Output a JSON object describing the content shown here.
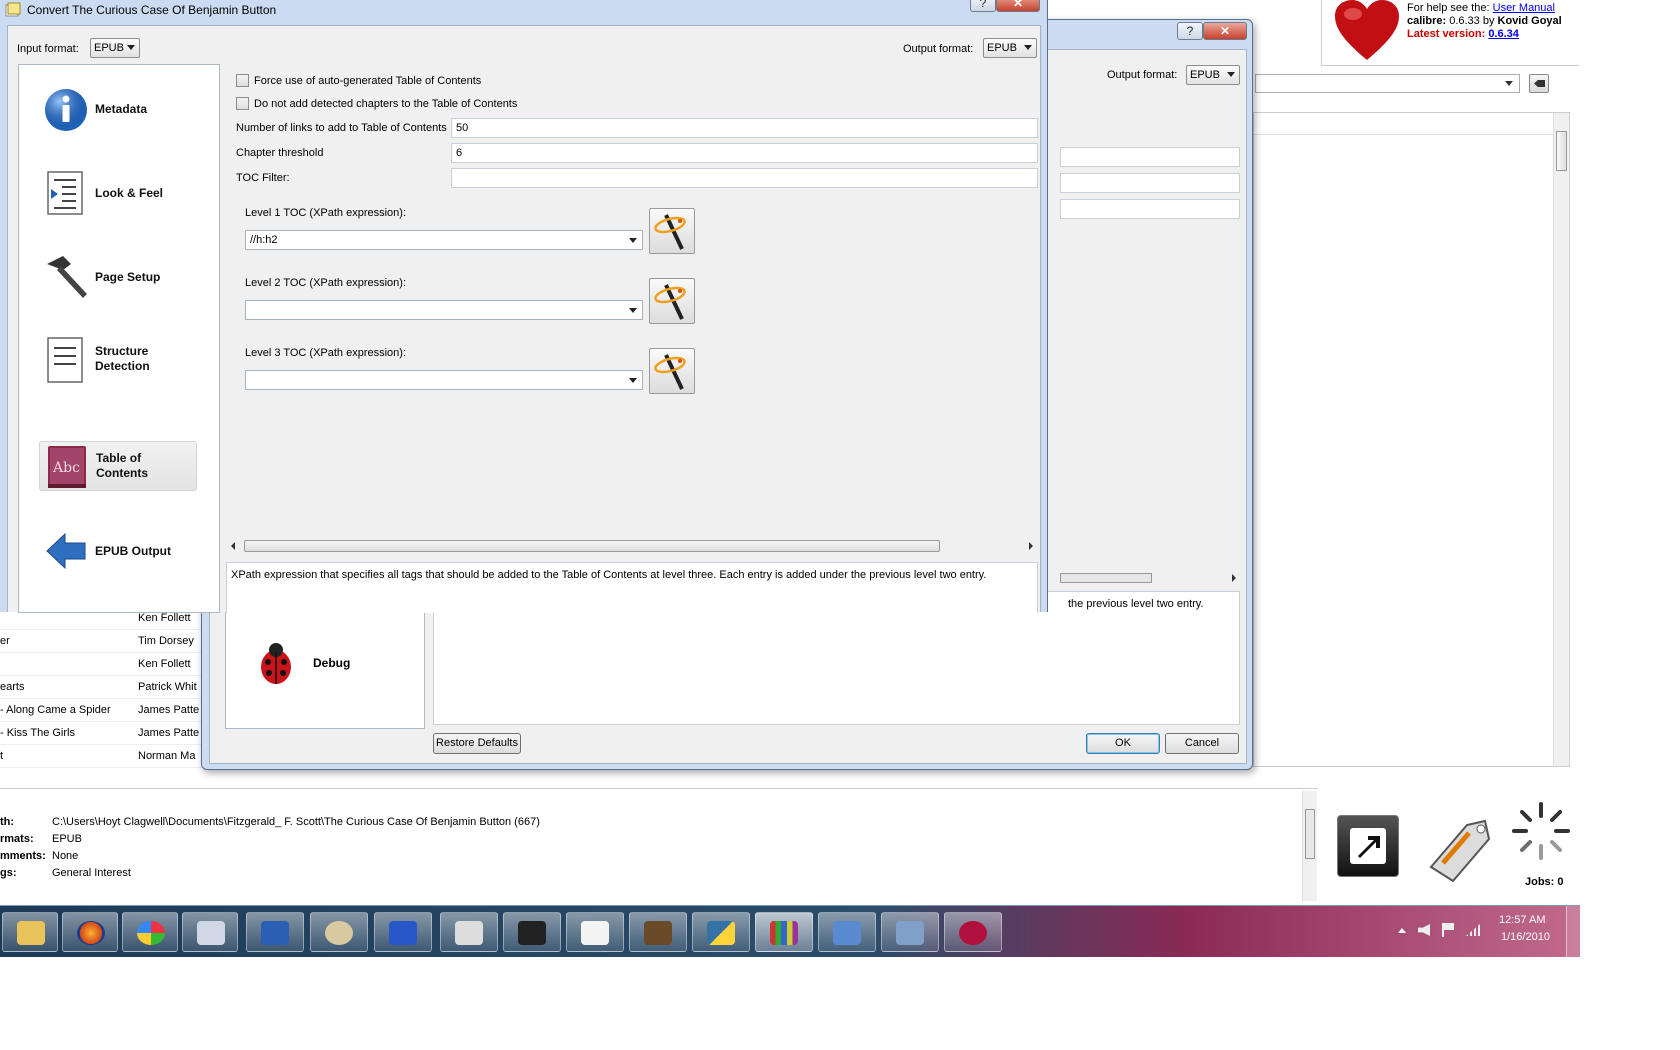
{
  "colors": {
    "accent": "#0066cc",
    "taskbar": "#6b2a4a",
    "latest": "#cc0000"
  },
  "header": {
    "help_prefix": "For help see the:",
    "help_link": "User Manual",
    "version_app": "calibre:",
    "version_text": "0.6.33 by",
    "version_author": "Kovid Goyal",
    "latest_label": "Latest version:",
    "latest_value": "0.6.34"
  },
  "main_window": {
    "books": [
      {
        "title": "",
        "author": "Ken Follett"
      },
      {
        "title": "er",
        "author": "Tim Dorsey"
      },
      {
        "title": "",
        "author": "Ken Follett"
      },
      {
        "title": "earts",
        "author": "Patrick Whit"
      },
      {
        "title": "- Along Came a Spider",
        "author": "James Patte"
      },
      {
        "title": "- Kiss The Girls",
        "author": "James Patte"
      },
      {
        "title": "t",
        "author": "Norman Ma"
      }
    ],
    "details": [
      {
        "label": "th:",
        "value": "C:\\Users\\Hoyt Clagwell\\Documents\\Fitzgerald_ F. Scott\\The Curious Case Of Benjamin Button (667)"
      },
      {
        "label": "rmats:",
        "value": "EPUB"
      },
      {
        "label": "mments:",
        "value": "None"
      },
      {
        "label": "gs:",
        "value": "General Interest"
      }
    ],
    "jobs": "Jobs: 0"
  },
  "back_dialog": {
    "help_btn": "?",
    "close_btn": "✕",
    "output_format_label": "Output format:",
    "output_format_value": "EPUB",
    "help_text": "the previous level two entry.",
    "debug_label": "Debug",
    "restore_defaults": "Restore Defaults",
    "ok": "OK",
    "cancel": "Cancel"
  },
  "dialog": {
    "title": "Convert The Curious Case Of Benjamin Button",
    "help_btn": "?",
    "close_btn": "✕",
    "input_format_label": "Input format:",
    "input_format_value": "EPUB",
    "output_format_label": "Output format:",
    "output_format_value": "EPUB",
    "nav": [
      {
        "label": "Metadata",
        "icon": "info-icon"
      },
      {
        "label": "Look & Feel",
        "icon": "look-feel-icon"
      },
      {
        "label": "Page Setup",
        "icon": "hammer-icon"
      },
      {
        "label": "Structure\nDetection",
        "icon": "structure-icon"
      },
      {
        "label": "Table of\nContents",
        "icon": "abc-book-icon"
      },
      {
        "label": "EPUB Output",
        "icon": "arrow-left-icon"
      }
    ],
    "force_toc": "Force use of auto-generated Table of Contents",
    "no_chapters": "Do not add detected chapters to the Table of Contents",
    "links_label": "Number of links to add to Table of Contents",
    "links_value": "50",
    "threshold_label": "Chapter threshold",
    "threshold_value": "6",
    "toc_filter_label": "TOC Filter:",
    "toc_filter_value": "",
    "level1_label": "Level 1 TOC (XPath expression):",
    "level1_value": "//h:h2",
    "level2_label": "Level 2 TOC (XPath expression):",
    "level2_value": "",
    "level3_label": "Level 3 TOC (XPath expression):",
    "level3_value": "",
    "help_text": "XPath expression that specifies all tags that should be added to the Table of Contents at level three. Each entry is added under the previous level two entry."
  },
  "taskbar": {
    "time": "12:57 AM",
    "date": "1/16/2010",
    "apps": [
      "explorer",
      "firefox",
      "windows-media",
      "calculator",
      "word",
      "paint",
      "book-app",
      "tool-app",
      "media-player",
      "reader",
      "notes",
      "python",
      "calibre",
      "network",
      "remote",
      "app-s"
    ]
  }
}
